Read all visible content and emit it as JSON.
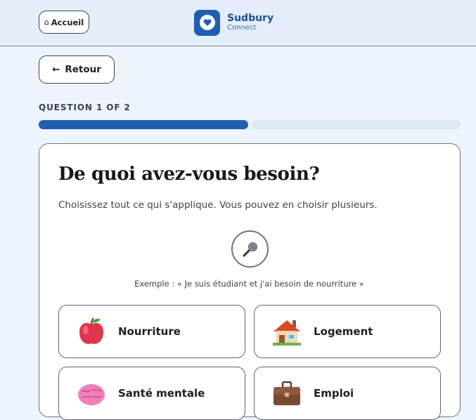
{
  "header": {
    "home_label": "Accueil",
    "brand_name": "Sudbury",
    "brand_sub": "Connect"
  },
  "nav": {
    "back_label": "Retour"
  },
  "progress": {
    "label": "QUESTION 1 OF 2",
    "current": 1,
    "total": 2
  },
  "question": {
    "title": "De quoi avez-vous besoin?",
    "subtitle": "Choisissez tout ce qui s'applique. Vous pouvez en choisir plusieurs.",
    "example": "Exemple : « Je suis étudiant et j'ai besoin de nourriture »"
  },
  "options": [
    {
      "label": "Nourriture",
      "icon": "apple-icon"
    },
    {
      "label": "Logement",
      "icon": "house-icon"
    },
    {
      "label": "Santé mentale",
      "icon": "brain-icon"
    },
    {
      "label": "Emploi",
      "icon": "briefcase-icon"
    }
  ],
  "colors": {
    "brand": "#1f5fb0",
    "progress_fill": "#1f5fb0",
    "progress_track": "#dde8f5"
  }
}
